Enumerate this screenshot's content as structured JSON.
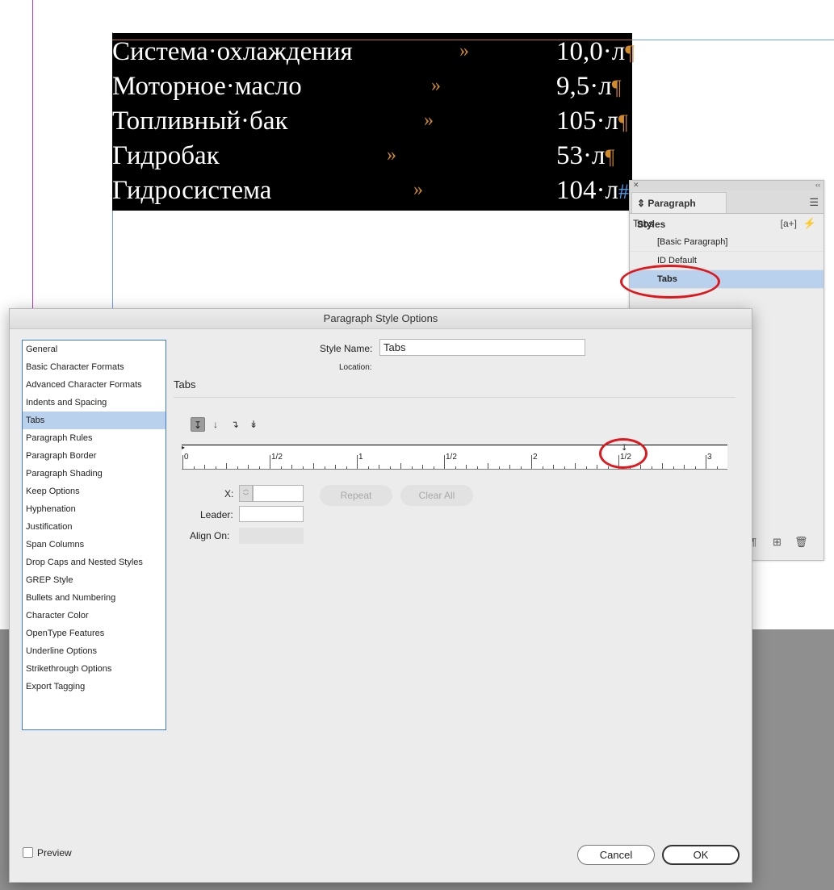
{
  "document": {
    "rows": [
      {
        "label": "Система·охлаждения",
        "value": "10,0·л",
        "end_mark": "¶"
      },
      {
        "label": "Моторное·масло",
        "value": "9,5·л",
        "end_mark": "¶"
      },
      {
        "label": "Топливный·бак",
        "value": "105·л",
        "end_mark": "¶"
      },
      {
        "label": "Гидробак",
        "value": "53·л",
        "end_mark": "¶"
      },
      {
        "label": "Гидросистема",
        "value": "104·л",
        "end_mark": "#"
      }
    ],
    "tab_mark": "»"
  },
  "styles_panel": {
    "tab_label": "Paragraph Styles",
    "current_style": "Tabs",
    "new_style_icon": "[a+]",
    "items": [
      {
        "label": "[Basic Paragraph]",
        "selected": false
      },
      {
        "label": "ID Default",
        "selected": false
      },
      {
        "label": "Tabs",
        "selected": true
      }
    ]
  },
  "dialog": {
    "title": "Paragraph Style Options",
    "sidebar": [
      {
        "label": "General",
        "selected": false
      },
      {
        "label": "Basic Character Formats",
        "selected": false
      },
      {
        "label": "Advanced Character Formats",
        "selected": false
      },
      {
        "label": "Indents and Spacing",
        "selected": false
      },
      {
        "label": "Tabs",
        "selected": true
      },
      {
        "label": "Paragraph Rules",
        "selected": false
      },
      {
        "label": "Paragraph Border",
        "selected": false
      },
      {
        "label": "Paragraph Shading",
        "selected": false
      },
      {
        "label": "Keep Options",
        "selected": false
      },
      {
        "label": "Hyphenation",
        "selected": false
      },
      {
        "label": "Justification",
        "selected": false
      },
      {
        "label": "Span Columns",
        "selected": false
      },
      {
        "label": "Drop Caps and Nested Styles",
        "selected": false
      },
      {
        "label": "GREP Style",
        "selected": false
      },
      {
        "label": "Bullets and Numbering",
        "selected": false
      },
      {
        "label": "Character Color",
        "selected": false
      },
      {
        "label": "OpenType Features",
        "selected": false
      },
      {
        "label": "Underline Options",
        "selected": false
      },
      {
        "label": "Strikethrough Options",
        "selected": false
      },
      {
        "label": "Export Tagging",
        "selected": false
      }
    ],
    "style_name_label": "Style Name:",
    "style_name_value": "Tabs",
    "location_label": "Location:",
    "section_title": "Tabs",
    "ruler_labels": [
      "0",
      "1/2",
      "1",
      "1/2",
      "2",
      "1/2",
      "3"
    ],
    "x_label": "X:",
    "x_value": "",
    "leader_label": "Leader:",
    "leader_value": "",
    "align_on_label": "Align On:",
    "repeat_label": "Repeat",
    "clear_all_label": "Clear All",
    "preview_label": "Preview",
    "preview_checked": false,
    "cancel_label": "Cancel",
    "ok_label": "OK"
  },
  "colors": {
    "selection": "#b9d1ec",
    "annotation_red": "#e0181e",
    "hidden_char_orange": "#d08a2a"
  }
}
